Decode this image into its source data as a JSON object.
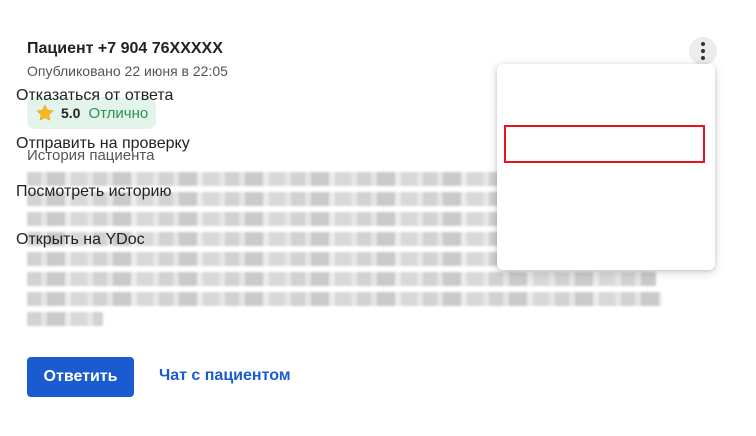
{
  "review": {
    "patient_title": "Пациент +7 904 76XXXXX",
    "published": "Опубликовано 22 июня в 22:05",
    "rating": {
      "value": "5.0",
      "label": "Отлично",
      "icon": "star-icon",
      "color": "#2f8f55"
    },
    "history_label": "История пациента"
  },
  "actions": {
    "reply_label": "Ответить",
    "chat_label": "Чат с пациентом"
  },
  "menu": {
    "items": [
      {
        "label": "Отказаться от ответа"
      },
      {
        "label": "Отправить на проверку",
        "highlighted": true
      },
      {
        "label": "Посмотреть историю"
      },
      {
        "label": "Открыть на YDoc"
      }
    ]
  },
  "colors": {
    "primary": "#1a5cd0",
    "highlight": "#e3141a",
    "badge_bg": "#e3f4ea"
  }
}
